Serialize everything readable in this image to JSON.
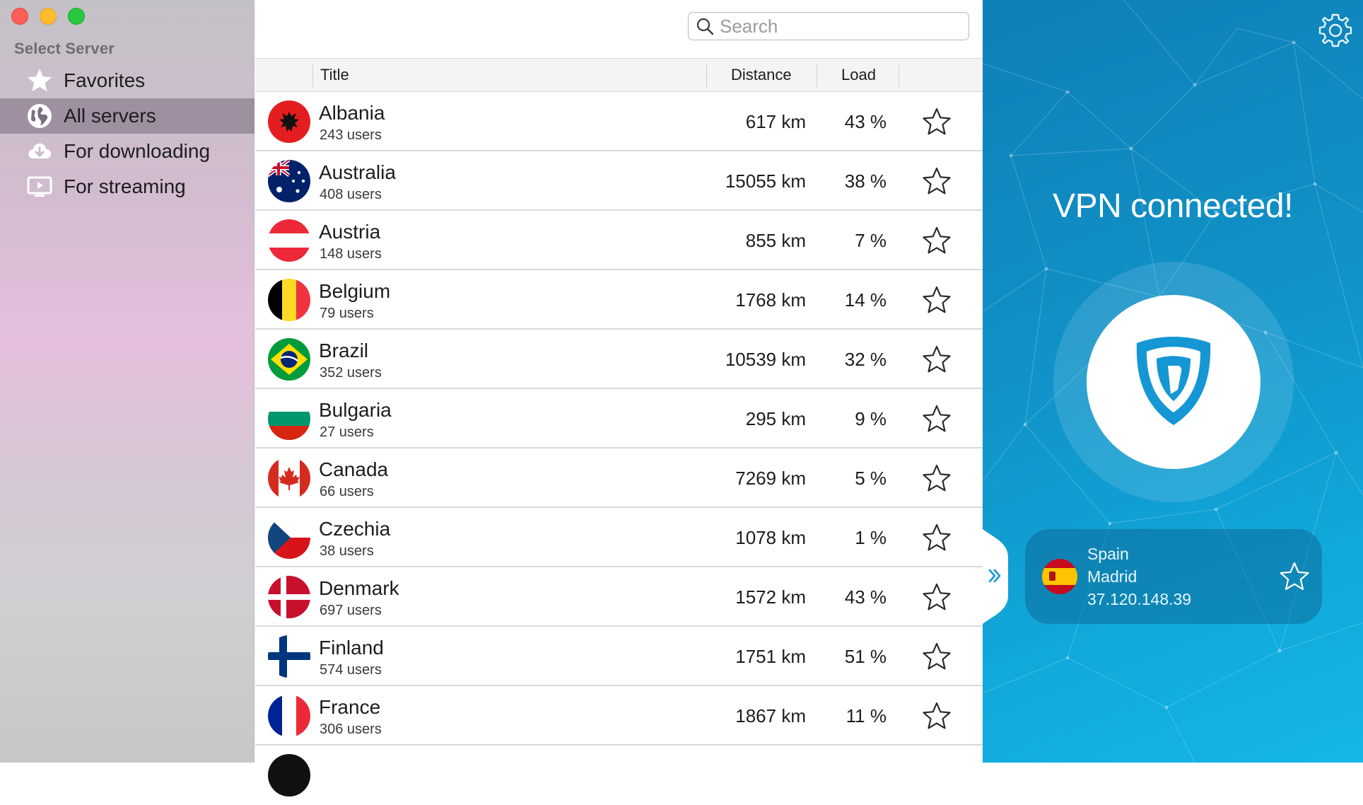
{
  "sidebar": {
    "heading": "Select Server",
    "items": [
      {
        "label": "Favorites",
        "icon": "star-icon"
      },
      {
        "label": "All servers",
        "icon": "globe-icon",
        "selected": true
      },
      {
        "label": "For downloading",
        "icon": "cloud-download-icon"
      },
      {
        "label": "For streaming",
        "icon": "tv-play-icon"
      }
    ]
  },
  "search": {
    "placeholder": "Search",
    "value": ""
  },
  "table": {
    "headers": {
      "title": "Title",
      "distance": "Distance",
      "load": "Load"
    },
    "rows": [
      {
        "country": "Albania",
        "users": "243 users",
        "distance": "617 km",
        "load": "43 %",
        "flag": "albania"
      },
      {
        "country": "Australia",
        "users": "408 users",
        "distance": "15055 km",
        "load": "38 %",
        "flag": "australia"
      },
      {
        "country": "Austria",
        "users": "148 users",
        "distance": "855 km",
        "load": "7 %",
        "flag": "austria"
      },
      {
        "country": "Belgium",
        "users": "79 users",
        "distance": "1768 km",
        "load": "14 %",
        "flag": "belgium"
      },
      {
        "country": "Brazil",
        "users": "352 users",
        "distance": "10539 km",
        "load": "32 %",
        "flag": "brazil"
      },
      {
        "country": "Bulgaria",
        "users": "27 users",
        "distance": "295 km",
        "load": "9 %",
        "flag": "bulgaria"
      },
      {
        "country": "Canada",
        "users": "66 users",
        "distance": "7269 km",
        "load": "5 %",
        "flag": "canada"
      },
      {
        "country": "Czechia",
        "users": "38 users",
        "distance": "1078 km",
        "load": "1 %",
        "flag": "czechia"
      },
      {
        "country": "Denmark",
        "users": "697 users",
        "distance": "1572 km",
        "load": "43 %",
        "flag": "denmark"
      },
      {
        "country": "Finland",
        "users": "574 users",
        "distance": "1751 km",
        "load": "51 %",
        "flag": "finland"
      },
      {
        "country": "France",
        "users": "306 users",
        "distance": "1867 km",
        "load": "11 %",
        "flag": "france"
      }
    ]
  },
  "vpn": {
    "status": "VPN connected!",
    "location": {
      "country": "Spain",
      "city": "Madrid",
      "ip": "37.120.148.39",
      "flag": "spain"
    }
  },
  "colors": {
    "accent": "#1497d4",
    "panel_gradient_start": "#0f7fb7",
    "panel_gradient_end": "#15b6e6",
    "sidebar_selected": "#8a7c8e"
  }
}
